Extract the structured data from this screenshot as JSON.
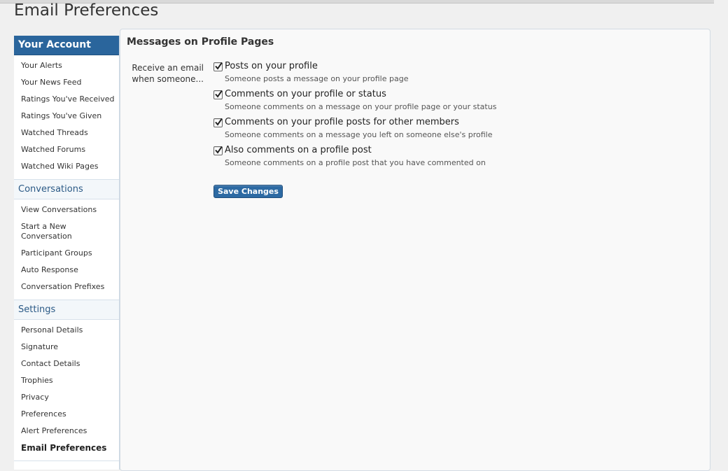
{
  "page": {
    "title": "Email Preferences"
  },
  "sidebar": {
    "sections": [
      {
        "heading": "Your Account",
        "items": [
          "Your Alerts",
          "Your News Feed",
          "Ratings You've Received",
          "Ratings You've Given",
          "Watched Threads",
          "Watched Forums",
          "Watched Wiki Pages"
        ]
      },
      {
        "heading": "Conversations",
        "items": [
          "View Conversations",
          "Start a New Conversation",
          "Participant Groups",
          "Auto Response",
          "Conversation Prefixes"
        ]
      },
      {
        "heading": "Settings",
        "items": [
          "Personal Details",
          "Signature",
          "Contact Details",
          "Trophies",
          "Privacy",
          "Preferences",
          "Alert Preferences",
          "Email Preferences"
        ]
      }
    ],
    "active_item": "Email Preferences"
  },
  "main": {
    "section_title": "Messages on Profile Pages",
    "field_label": "Receive an email when someone...",
    "options": [
      {
        "label": "Posts on your profile",
        "description": "Someone posts a message on your profile page",
        "checked": true
      },
      {
        "label": "Comments on your profile or status",
        "description": "Someone comments on a message on your profile page or your status",
        "checked": true
      },
      {
        "label": "Comments on your profile posts for other members",
        "description": "Someone comments on a message you left on someone else's profile",
        "checked": true
      },
      {
        "label": "Also comments on a profile post",
        "description": "Someone comments on a profile post that you have commented on",
        "checked": true
      }
    ],
    "save_label": "Save Changes"
  },
  "colors": {
    "accent": "#2a659c",
    "button": "#2d6aa3",
    "background": "#f0f0f0"
  }
}
